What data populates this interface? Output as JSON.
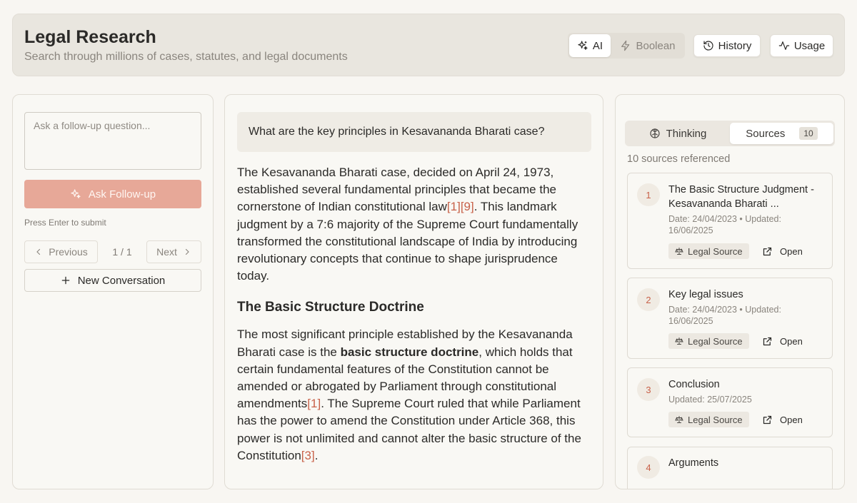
{
  "header": {
    "title": "Legal Research",
    "subtitle": "Search through millions of cases, statutes, and legal documents",
    "modes": [
      "AI",
      "Boolean"
    ],
    "selected_mode": "AI",
    "history_label": "History",
    "usage_label": "Usage"
  },
  "left": {
    "input_placeholder": "Ask a follow-up question...",
    "ask_label": "Ask Follow-up",
    "hint": "Press Enter to submit",
    "prev_label": "Previous",
    "page_count": "1 / 1",
    "next_label": "Next",
    "new_conversation_label": "New Conversation"
  },
  "main": {
    "question": "What are the key principles in Kesavananda Bharati case?",
    "para1_a": "The Kesavananda Bharati case, decided on April 24, 1973, established several fundamental principles that became the cornerstone of Indian constitutional law",
    "para1_cite1": "[1]",
    "para1_cite2": "[9]",
    "para1_b": ". This landmark judgment by a 7:6 majority of the Supreme Court fundamentally transformed the constitutional landscape of India by introducing revolutionary concepts that continue to shape jurisprudence today.",
    "heading": "The Basic Structure Doctrine",
    "para2_a": "The most significant principle established by the Kesavananda Bharati case is the ",
    "para2_bold": "basic structure doctrine",
    "para2_b": ", which holds that certain fundamental features of the Constitution cannot be amended or abrogated by Parliament through constitutional amendments",
    "para2_cite1": "[1]",
    "para2_c": ". The Supreme Court ruled that while Parliament has the power to amend the Constitution under Article 368, this power is not unlimited and cannot alter the basic structure of the Constitution",
    "para2_cite2": "[3]",
    "para2_d": "."
  },
  "right": {
    "tab_thinking": "Thinking",
    "tab_sources": "Sources",
    "sources_badge": "10",
    "selected_tab": "Sources",
    "sources_count_text": "10 sources referenced",
    "tag_label": "Legal Source",
    "open_label": "Open",
    "sources": [
      {
        "num": "1",
        "title": "The Basic Structure Judgment - Kesavananda Bharati ...",
        "meta": "Date: 24/04/2023 • Updated: 16/06/2025"
      },
      {
        "num": "2",
        "title": "Key legal issues",
        "meta": "Date: 24/04/2023 • Updated: 16/06/2025"
      },
      {
        "num": "3",
        "title": "Conclusion",
        "meta": "Updated: 25/07/2025"
      },
      {
        "num": "4",
        "title": "Arguments",
        "meta": ""
      }
    ]
  },
  "colors": {
    "accent": "#c8624a",
    "ask_button": "#e7a898",
    "background": "#f8f6f2",
    "header_bg": "#e9e6df"
  }
}
